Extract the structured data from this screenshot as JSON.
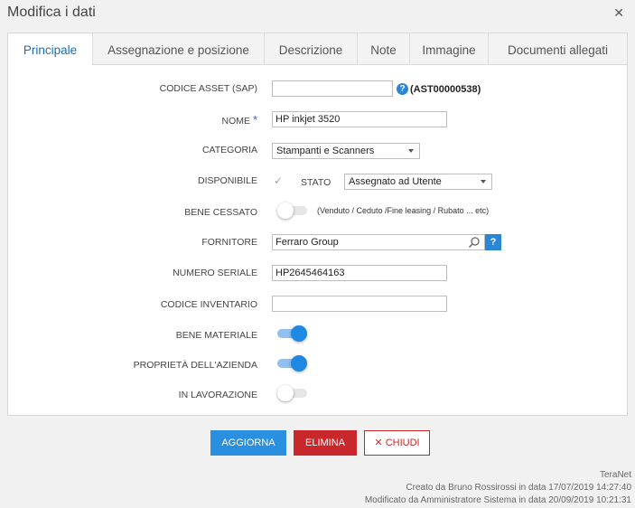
{
  "window": {
    "title": "Modifica i dati",
    "close_icon": "close-icon"
  },
  "tabs": [
    {
      "label": "Principale",
      "active": true
    },
    {
      "label": "Assegnazione e posizione"
    },
    {
      "label": "Descrizione"
    },
    {
      "label": "Note"
    },
    {
      "label": "Immagine"
    },
    {
      "label": "Documenti allegati"
    }
  ],
  "form": {
    "codice_asset": {
      "label": "CODICE ASSET (SAP)",
      "value": "",
      "code": "(AST00000538)"
    },
    "nome": {
      "label": "NOME",
      "required_mark": "*",
      "value": "HP inkjet 3520"
    },
    "categoria": {
      "label": "CATEGORIA",
      "value": "Stampanti e Scanners"
    },
    "disponibile": {
      "label": "DISPONIBILE",
      "check": "✓",
      "stato_label": "STATO",
      "stato_value": "Assegnato ad Utente"
    },
    "bene_cessato": {
      "label": "BENE CESSATO",
      "on": false,
      "hint": "(Venduto / Ceduto /Fine leasing / Rubato ... etc)"
    },
    "fornitore": {
      "label": "FORNITORE",
      "value": "Ferraro Group",
      "help": "?"
    },
    "numero_seriale": {
      "label": "NUMERO SERIALE",
      "value": "HP2645464163"
    },
    "codice_inventario": {
      "label": "CODICE INVENTARIO",
      "value": ""
    },
    "bene_materiale": {
      "label": "BENE MATERIALE",
      "on": true
    },
    "proprieta": {
      "label": "PROPRIETÀ DELL'AZIENDA",
      "on": true
    },
    "in_lavorazione": {
      "label": "IN LAVORAZIONE",
      "on": false
    }
  },
  "buttons": {
    "update": "AGGIORNA",
    "delete": "ELIMINA",
    "close": "CHIUDI",
    "close_icon": "✕"
  },
  "footer": {
    "brand": "TeraNet",
    "created": "Creato da Bruno Rossirossi in data 17/07/2019 14:27:40",
    "modified": "Modificato da Amministratore Sistema in data 20/09/2019 10:21:31"
  },
  "colors": {
    "accent": "#2b8fe0",
    "danger": "#c8282b",
    "tab_active": "#1a6fb4"
  }
}
